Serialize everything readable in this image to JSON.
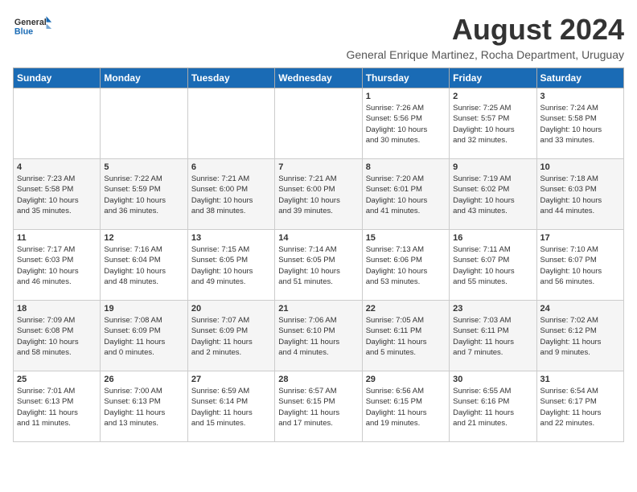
{
  "header": {
    "logo_general": "General",
    "logo_blue": "Blue",
    "month_title": "August 2024",
    "location": "General Enrique Martinez, Rocha Department, Uruguay"
  },
  "weekdays": [
    "Sunday",
    "Monday",
    "Tuesday",
    "Wednesday",
    "Thursday",
    "Friday",
    "Saturday"
  ],
  "weeks": [
    [
      {
        "day": "",
        "info": ""
      },
      {
        "day": "",
        "info": ""
      },
      {
        "day": "",
        "info": ""
      },
      {
        "day": "",
        "info": ""
      },
      {
        "day": "1",
        "info": "Sunrise: 7:26 AM\nSunset: 5:56 PM\nDaylight: 10 hours\nand 30 minutes."
      },
      {
        "day": "2",
        "info": "Sunrise: 7:25 AM\nSunset: 5:57 PM\nDaylight: 10 hours\nand 32 minutes."
      },
      {
        "day": "3",
        "info": "Sunrise: 7:24 AM\nSunset: 5:58 PM\nDaylight: 10 hours\nand 33 minutes."
      }
    ],
    [
      {
        "day": "4",
        "info": "Sunrise: 7:23 AM\nSunset: 5:58 PM\nDaylight: 10 hours\nand 35 minutes."
      },
      {
        "day": "5",
        "info": "Sunrise: 7:22 AM\nSunset: 5:59 PM\nDaylight: 10 hours\nand 36 minutes."
      },
      {
        "day": "6",
        "info": "Sunrise: 7:21 AM\nSunset: 6:00 PM\nDaylight: 10 hours\nand 38 minutes."
      },
      {
        "day": "7",
        "info": "Sunrise: 7:21 AM\nSunset: 6:00 PM\nDaylight: 10 hours\nand 39 minutes."
      },
      {
        "day": "8",
        "info": "Sunrise: 7:20 AM\nSunset: 6:01 PM\nDaylight: 10 hours\nand 41 minutes."
      },
      {
        "day": "9",
        "info": "Sunrise: 7:19 AM\nSunset: 6:02 PM\nDaylight: 10 hours\nand 43 minutes."
      },
      {
        "day": "10",
        "info": "Sunrise: 7:18 AM\nSunset: 6:03 PM\nDaylight: 10 hours\nand 44 minutes."
      }
    ],
    [
      {
        "day": "11",
        "info": "Sunrise: 7:17 AM\nSunset: 6:03 PM\nDaylight: 10 hours\nand 46 minutes."
      },
      {
        "day": "12",
        "info": "Sunrise: 7:16 AM\nSunset: 6:04 PM\nDaylight: 10 hours\nand 48 minutes."
      },
      {
        "day": "13",
        "info": "Sunrise: 7:15 AM\nSunset: 6:05 PM\nDaylight: 10 hours\nand 49 minutes."
      },
      {
        "day": "14",
        "info": "Sunrise: 7:14 AM\nSunset: 6:05 PM\nDaylight: 10 hours\nand 51 minutes."
      },
      {
        "day": "15",
        "info": "Sunrise: 7:13 AM\nSunset: 6:06 PM\nDaylight: 10 hours\nand 53 minutes."
      },
      {
        "day": "16",
        "info": "Sunrise: 7:11 AM\nSunset: 6:07 PM\nDaylight: 10 hours\nand 55 minutes."
      },
      {
        "day": "17",
        "info": "Sunrise: 7:10 AM\nSunset: 6:07 PM\nDaylight: 10 hours\nand 56 minutes."
      }
    ],
    [
      {
        "day": "18",
        "info": "Sunrise: 7:09 AM\nSunset: 6:08 PM\nDaylight: 10 hours\nand 58 minutes."
      },
      {
        "day": "19",
        "info": "Sunrise: 7:08 AM\nSunset: 6:09 PM\nDaylight: 11 hours\nand 0 minutes."
      },
      {
        "day": "20",
        "info": "Sunrise: 7:07 AM\nSunset: 6:09 PM\nDaylight: 11 hours\nand 2 minutes."
      },
      {
        "day": "21",
        "info": "Sunrise: 7:06 AM\nSunset: 6:10 PM\nDaylight: 11 hours\nand 4 minutes."
      },
      {
        "day": "22",
        "info": "Sunrise: 7:05 AM\nSunset: 6:11 PM\nDaylight: 11 hours\nand 5 minutes."
      },
      {
        "day": "23",
        "info": "Sunrise: 7:03 AM\nSunset: 6:11 PM\nDaylight: 11 hours\nand 7 minutes."
      },
      {
        "day": "24",
        "info": "Sunrise: 7:02 AM\nSunset: 6:12 PM\nDaylight: 11 hours\nand 9 minutes."
      }
    ],
    [
      {
        "day": "25",
        "info": "Sunrise: 7:01 AM\nSunset: 6:13 PM\nDaylight: 11 hours\nand 11 minutes."
      },
      {
        "day": "26",
        "info": "Sunrise: 7:00 AM\nSunset: 6:13 PM\nDaylight: 11 hours\nand 13 minutes."
      },
      {
        "day": "27",
        "info": "Sunrise: 6:59 AM\nSunset: 6:14 PM\nDaylight: 11 hours\nand 15 minutes."
      },
      {
        "day": "28",
        "info": "Sunrise: 6:57 AM\nSunset: 6:15 PM\nDaylight: 11 hours\nand 17 minutes."
      },
      {
        "day": "29",
        "info": "Sunrise: 6:56 AM\nSunset: 6:15 PM\nDaylight: 11 hours\nand 19 minutes."
      },
      {
        "day": "30",
        "info": "Sunrise: 6:55 AM\nSunset: 6:16 PM\nDaylight: 11 hours\nand 21 minutes."
      },
      {
        "day": "31",
        "info": "Sunrise: 6:54 AM\nSunset: 6:17 PM\nDaylight: 11 hours\nand 22 minutes."
      }
    ]
  ]
}
